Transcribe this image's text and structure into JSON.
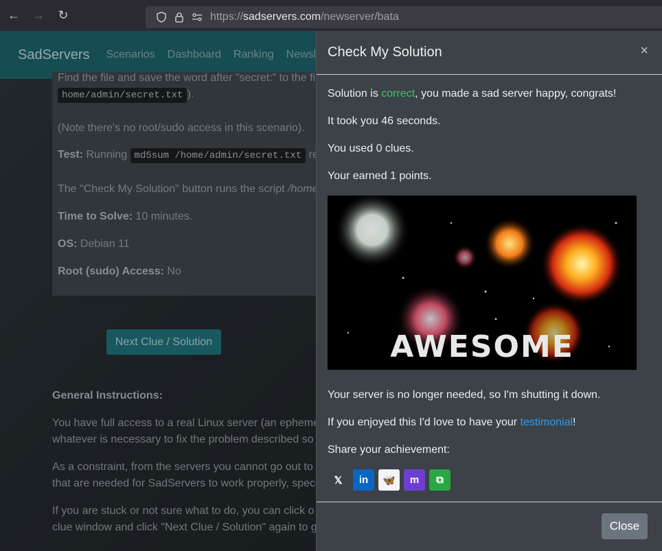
{
  "browser": {
    "url_prefix": "https://",
    "url_domain": "sadservers.com",
    "url_path": "/newserver/bata"
  },
  "navbar": {
    "brand": "SadServers",
    "links": [
      "Scenarios",
      "Dashboard",
      "Ranking",
      "Newsle"
    ]
  },
  "background": {
    "line1": "Find the file and save the word after \"secret:\" to the fi",
    "line2_code": "home/admin/secret.txt",
    "line2_suffix": ").",
    "note": "(Note there's no root/sudo access in this scenario).",
    "test_label": "Test:",
    "test_text": " Running ",
    "test_code": "md5sum /home/admin/secret.txt",
    "test_suffix": " re",
    "check_text": "The \"Check My Solution\" button runs the script ",
    "check_path": "/home",
    "time_label": "Time to Solve:",
    "time_value": " 10 minutes.",
    "os_label": "OS:",
    "os_value": " Debian 11",
    "root_label": "Root (sudo) Access:",
    "root_value": " No",
    "clue_button": "Next Clue / Solution",
    "gi_title": "General Instructions:",
    "gi_p1_l1": "You have full access to a real Linux server (an epheme",
    "gi_p1_l2": "whatever is necessary to fix the problem described so",
    "gi_p2_l1": "As a constraint, from the servers you cannot go out to",
    "gi_p2_l2": "that are needed for SadServers to work properly, spec",
    "gi_p3_l1": "If you are stuck or not sure what to do, you can click o",
    "gi_p3_l2": "clue window and click \"Next Clue / Solution\" again to g"
  },
  "modal": {
    "title": "Check My Solution",
    "close_x": "×",
    "solution_prefix": "Solution is ",
    "solution_status": "correct",
    "solution_suffix": ", you made a sad server happy, congrats!",
    "time_took": "It took you 46 seconds.",
    "clues_used": "You used 0 clues.",
    "points": "Your earned 1 points.",
    "fireworks_text": "AWESOME",
    "shutdown": "Your server is no longer needed, so I'm shutting it down.",
    "testimonial_prefix": "If you enjoyed this I'd love to have your ",
    "testimonial_link": "testimonial",
    "testimonial_suffix": "!",
    "share_label": "Share your achievement:",
    "share_buttons": [
      {
        "name": "x",
        "glyph": "𝕏",
        "color": "#3c4247"
      },
      {
        "name": "linkedin",
        "glyph": "in",
        "color": "#0a66c2"
      },
      {
        "name": "bluesky",
        "glyph": "🦋",
        "color": "#f3f4f5"
      },
      {
        "name": "mastodon",
        "glyph": "m",
        "color": "#6d3fd1"
      },
      {
        "name": "copy",
        "glyph": "⧉",
        "color": "#28a745"
      }
    ],
    "close_button": "Close"
  }
}
